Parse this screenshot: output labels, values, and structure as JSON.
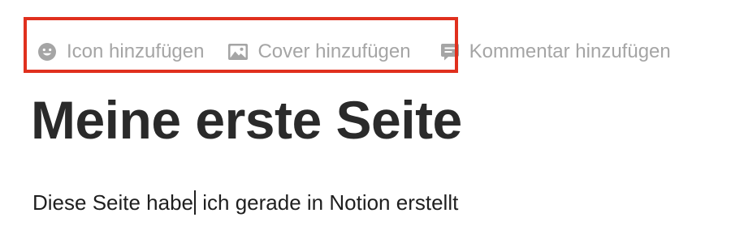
{
  "page_actions": {
    "icon": {
      "label": "Icon hinzufügen",
      "icon_name": "smiley-icon"
    },
    "cover": {
      "label": "Cover hinzufügen",
      "icon_name": "image-icon"
    },
    "comment": {
      "label": "Kommentar hinzufügen",
      "icon_name": "comment-icon"
    }
  },
  "highlight": {
    "color": "#e0301e"
  },
  "page": {
    "title": "Meine erste Seite",
    "body_before_caret": "Diese Seite habe",
    "body_after_caret": " ich gerade in Notion erstellt"
  }
}
